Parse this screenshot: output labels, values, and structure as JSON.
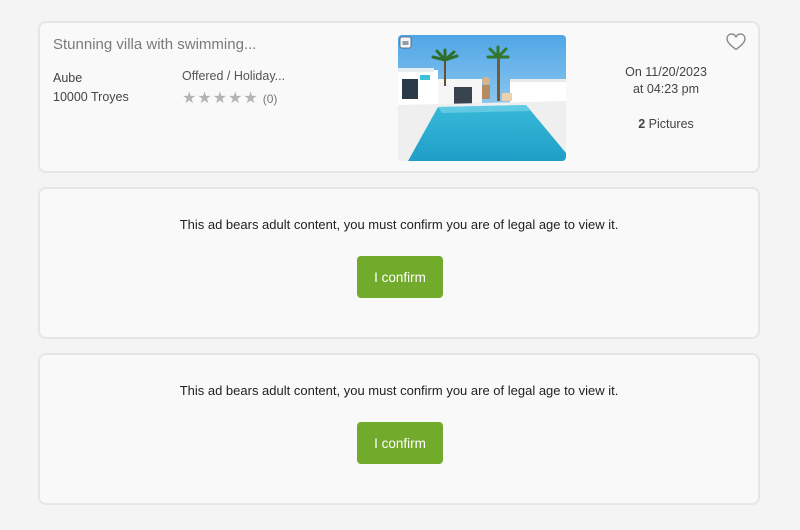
{
  "listing": {
    "title": "Stunning villa with swimming...",
    "region": "Aube",
    "city": "10000 Troyes",
    "category": "Offered / Holiday...",
    "rating_count": "(0)",
    "rating_stars": 0,
    "date_line1": "On 11/20/2023",
    "date_line2": "at 04:23 pm",
    "pictures_count": "2",
    "pictures_label": "Pictures",
    "heart_icon": "heart-outline",
    "photo_badge_icon": "camera-icon"
  },
  "adult_cards": [
    {
      "message": "This ad bears adult content, you must confirm you are of legal age to view it.",
      "button_label": "I confirm"
    },
    {
      "message": "This ad bears adult content, you must confirm you are of legal age to view it.",
      "button_label": "I confirm"
    }
  ],
  "colors": {
    "confirm": "#72aa2b",
    "star": "#b3b3b3"
  }
}
